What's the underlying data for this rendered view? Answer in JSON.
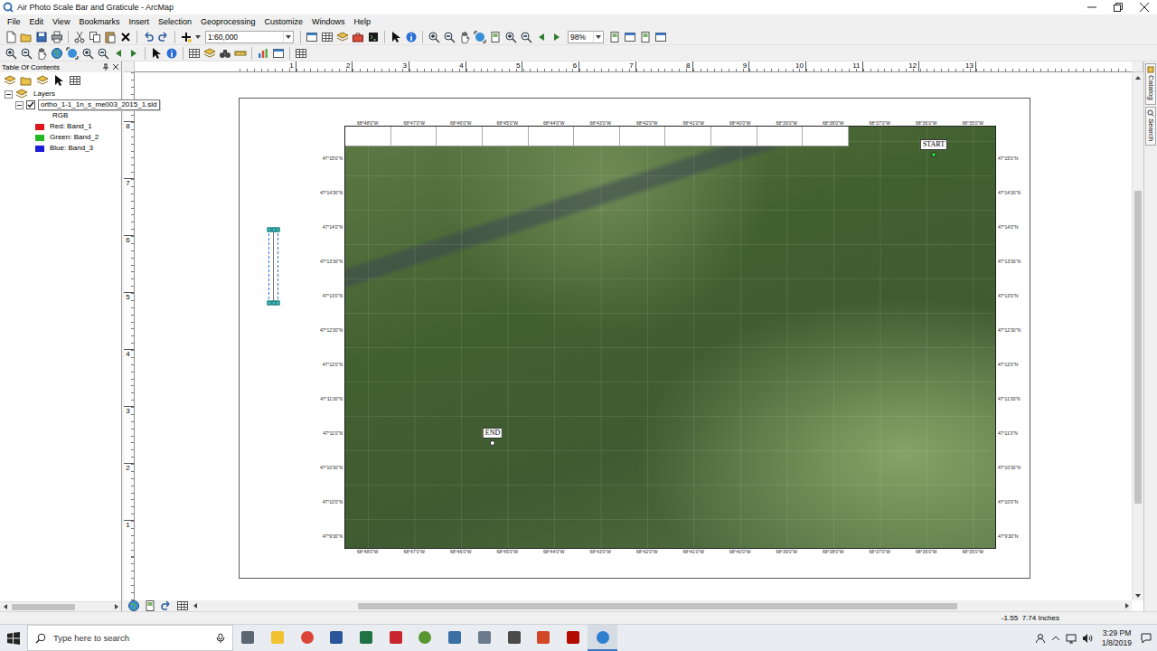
{
  "window": {
    "title": "Air Photo Scale Bar and Graticule - ArcMap"
  },
  "menu": [
    "File",
    "Edit",
    "View",
    "Bookmarks",
    "Insert",
    "Selection",
    "Geoprocessing",
    "Customize",
    "Windows",
    "Help"
  ],
  "toolbar": {
    "scale": "1:60,000",
    "zoom": "98%"
  },
  "toc": {
    "title": "Table Of Contents",
    "items": [
      {
        "label": "Layers",
        "kind": "group",
        "expanded": true
      },
      {
        "label": "ortho_1-1_1n_s_me003_2015_1.sid",
        "kind": "layer",
        "expanded": true,
        "checked": true,
        "selected": true
      },
      {
        "label": "RGB",
        "kind": "renderer"
      },
      {
        "label": "Red: Band_1",
        "kind": "band",
        "color": "#e0141c"
      },
      {
        "label": "Green: Band_2",
        "kind": "band",
        "color": "#22b822"
      },
      {
        "label": "Blue: Band_3",
        "kind": "band",
        "color": "#1a1ad8"
      }
    ]
  },
  "side_tabs": [
    "Catalog",
    "Search"
  ],
  "rulers": {
    "horizontal": [
      "1",
      "2",
      "3",
      "4",
      "5",
      "6",
      "7",
      "8",
      "9",
      "10",
      "11",
      "12",
      "13"
    ],
    "vertical": [
      "8",
      "7",
      "6",
      "5",
      "4",
      "3",
      "2",
      "1"
    ]
  },
  "layout": {
    "scale_bar": {
      "selected": true
    },
    "lon_labels": [
      "68°48'0\"W",
      "68°47'0\"W",
      "68°46'0\"W",
      "68°45'0\"W",
      "68°44'0\"W",
      "68°43'0\"W",
      "68°42'0\"W",
      "68°41'0\"W",
      "68°40'0\"W",
      "68°39'0\"W",
      "68°38'0\"W",
      "68°37'0\"W",
      "68°36'0\"W",
      "68°35'0\"W"
    ],
    "lat_labels": [
      "47°15'0\"N",
      "47°14'30\"N",
      "47°14'0\"N",
      "47°13'30\"N",
      "47°13'0\"N",
      "47°12'30\"N",
      "47°12'0\"N",
      "47°11'30\"N",
      "47°11'0\"N",
      "47°10'30\"N",
      "47°10'0\"N",
      "47°9'30\"N"
    ],
    "markers": [
      {
        "label": "START",
        "color": "#33d633"
      },
      {
        "label": "END",
        "color": "#ffffff"
      }
    ]
  },
  "status": {
    "coords": "-1.55  7.74 Inches"
  },
  "taskbar": {
    "search_placeholder": "Type here to search",
    "time": "3:29 PM",
    "date": "1/8/2019",
    "apps": [
      {
        "selected": false
      },
      {
        "selected": false
      },
      {
        "selected": false
      },
      {
        "selected": false
      },
      {
        "selected": false
      },
      {
        "selected": false
      },
      {
        "selected": false
      },
      {
        "selected": false
      },
      {
        "selected": false
      },
      {
        "selected": false
      },
      {
        "selected": false
      },
      {
        "selected": false
      },
      {
        "selected": true
      }
    ]
  }
}
